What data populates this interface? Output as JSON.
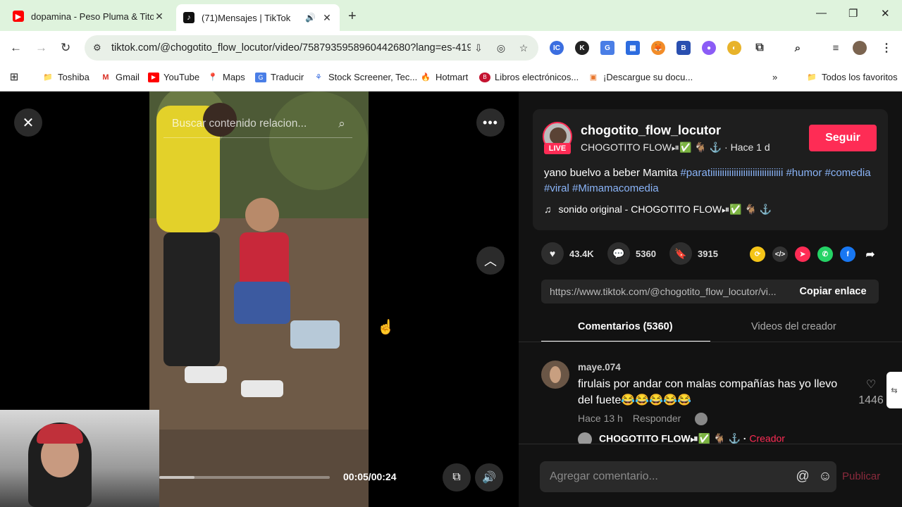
{
  "browser": {
    "tabs": [
      {
        "title": "dopamina - Peso Pluma & Tito",
        "favicon": "youtube-icon",
        "active": false
      },
      {
        "title": "(71)Mensajes | TikTok",
        "favicon": "tiktok-icon",
        "active": true
      }
    ],
    "url": "tiktok.com/@chogotito_flow_locutor/video/7587935958960442680?lang=es-419",
    "bookmarks": [
      "Toshiba",
      "Gmail",
      "YouTube",
      "Maps",
      "Traducir",
      "Stock Screener, Tec...",
      "Hotmart",
      "Libros electrónicos...",
      "¡Descargue su docu...",
      "Todos los favoritos"
    ]
  },
  "player": {
    "search_placeholder": "Buscar contenido relacion...",
    "time": "00:05/00:24",
    "progress_fraction": 0.2083
  },
  "post": {
    "username": "chogotito_flow_locutor",
    "live_badge": "LIVE",
    "display_name": "CHOGOTITO FLOW⏯✅ 🐐 ⚓",
    "age": "Hace 1 d",
    "follow_label": "Seguir",
    "caption": "yano buelvo a beber Mamita",
    "hashtags": [
      "#paratiiiiiiiiiiiiiiiiiiiiiiiiiiiiiii",
      "#humor",
      "#comedia",
      "#viral",
      "#Mimamacomedia"
    ],
    "sound": "sonido original - CHOGOTITO FLOW⏯✅ 🐐 ⚓"
  },
  "actions": {
    "likes": "43.4K",
    "comments": "5360",
    "saves": "3915"
  },
  "share": {
    "link": "https://www.tiktok.com/@chogotito_flow_locutor/vi...",
    "copy_label": "Copiar enlace"
  },
  "panel_tabs": {
    "comments": "Comentarios (5360)",
    "creator_videos": "Videos del creador"
  },
  "comment": {
    "user": "maye.074",
    "text": "firulais por andar con malas compañías has yo llevo del fuete😂😂😂😂😂",
    "time": "Hace 13 h",
    "reply": "Responder",
    "likes": "1446",
    "creator_reply_name": "CHOGOTITO FLOW⏯✅ 🐐 ⚓ ·",
    "creator_tag": "Creador"
  },
  "composer": {
    "placeholder": "Agregar comentario...",
    "publish_label": "Publicar"
  }
}
